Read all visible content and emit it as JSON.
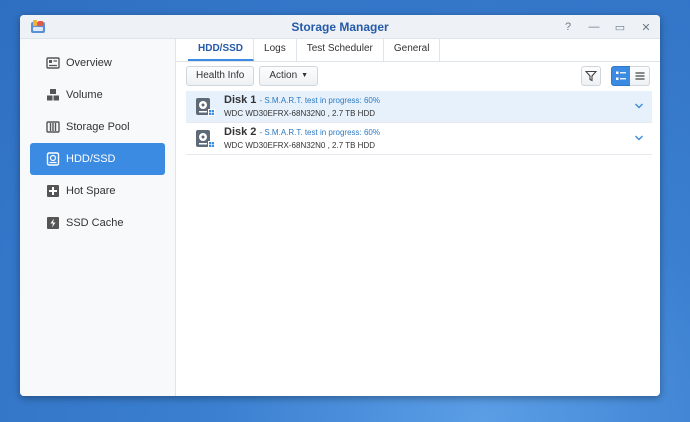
{
  "window": {
    "title": "Storage Manager"
  },
  "window_controls": [
    {
      "name": "help",
      "glyph": "?"
    },
    {
      "name": "minimize",
      "glyph": "—"
    },
    {
      "name": "maximize",
      "glyph": "▭"
    },
    {
      "name": "close",
      "glyph": "✕"
    }
  ],
  "sidebar": {
    "items": [
      {
        "label": "Overview",
        "icon": "overview-icon",
        "active": false
      },
      {
        "label": "Volume",
        "icon": "volume-icon",
        "active": false
      },
      {
        "label": "Storage Pool",
        "icon": "storage-pool-icon",
        "active": false
      },
      {
        "label": "HDD/SSD",
        "icon": "hdd-icon",
        "active": true
      },
      {
        "label": "Hot Spare",
        "icon": "hot-spare-icon",
        "active": false
      },
      {
        "label": "SSD Cache",
        "icon": "ssd-cache-icon",
        "active": false
      }
    ]
  },
  "tabs": [
    {
      "label": "HDD/SSD",
      "active": true
    },
    {
      "label": "Logs",
      "active": false
    },
    {
      "label": "Test Scheduler",
      "active": false
    },
    {
      "label": "General",
      "active": false
    }
  ],
  "toolbar": {
    "health_info_label": "Health Info",
    "action_label": "Action"
  },
  "disks": [
    {
      "name": "Disk 1",
      "status": "- S.M.A.R.T. test in progress: 60%",
      "details": "WDC WD30EFRX-68N32N0 , 2.7 TB HDD",
      "selected": true
    },
    {
      "name": "Disk 2",
      "status": "- S.M.A.R.T. test in progress: 60%",
      "details": "WDC WD30EFRX-68N32N0 , 2.7 TB HDD",
      "selected": false
    }
  ],
  "colors": {
    "accent": "#3c8be2",
    "title": "#245aa8",
    "status_link": "#2b79c5",
    "selected_row": "#e6f1fb"
  }
}
